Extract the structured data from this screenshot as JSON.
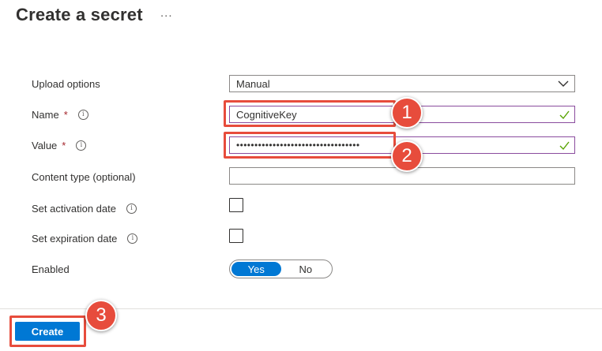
{
  "header": {
    "title": "Create a secret",
    "more_label": "..."
  },
  "form": {
    "upload_options": {
      "label": "Upload options",
      "value": "Manual"
    },
    "name": {
      "label": "Name",
      "required_mark": "*",
      "value": "CognitiveKey"
    },
    "value": {
      "label": "Value",
      "required_mark": "*",
      "masked_value": "••••••••••••••••••••••••••••••••••"
    },
    "content_type": {
      "label": "Content type (optional)",
      "value": ""
    },
    "activation_date": {
      "label": "Set activation date",
      "checked": false
    },
    "expiration_date": {
      "label": "Set expiration date",
      "checked": false
    },
    "enabled": {
      "label": "Enabled",
      "options": [
        "Yes",
        "No"
      ],
      "selected": "Yes"
    }
  },
  "footer": {
    "create_label": "Create"
  },
  "callouts": [
    "1",
    "2",
    "3"
  ],
  "icons": {
    "info": "info-icon",
    "check": "checkmark-icon",
    "chevron": "chevron-down-icon"
  },
  "colors": {
    "accent": "#0078d4",
    "highlight": "#e74c3c",
    "valid": "#57a300"
  }
}
